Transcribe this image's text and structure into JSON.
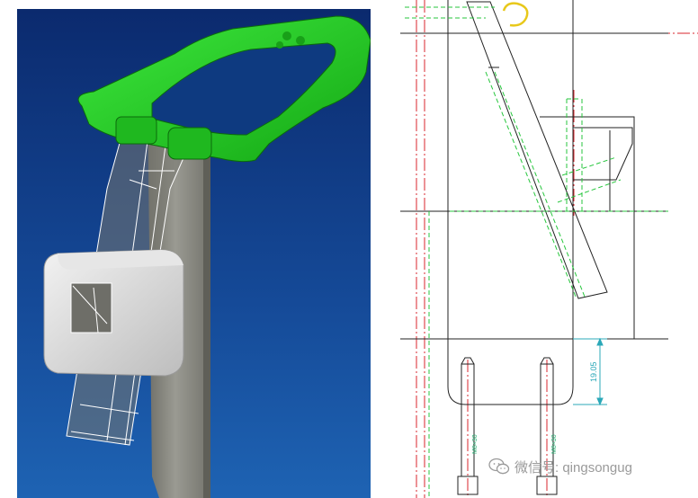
{
  "drawing": {
    "dimension_value": "19.05",
    "bolt_left_label": "M8×30",
    "bolt_right_label": "M8×30"
  },
  "watermark": {
    "text": "微信号: qingsongug",
    "icon": "wechat-icon"
  },
  "colors": {
    "render_background_top": "#0b2a6e",
    "render_background_bottom": "#1a5aa8",
    "part_green": "#22cc22",
    "post_gray": "#8a8a82",
    "block_gray": "#d6d6d6",
    "dimension_cyan": "#2ba8b8",
    "centerline_red": "#d9262e",
    "hidden_green": "#27c63d",
    "highlight_yellow": "#e8c81a"
  }
}
